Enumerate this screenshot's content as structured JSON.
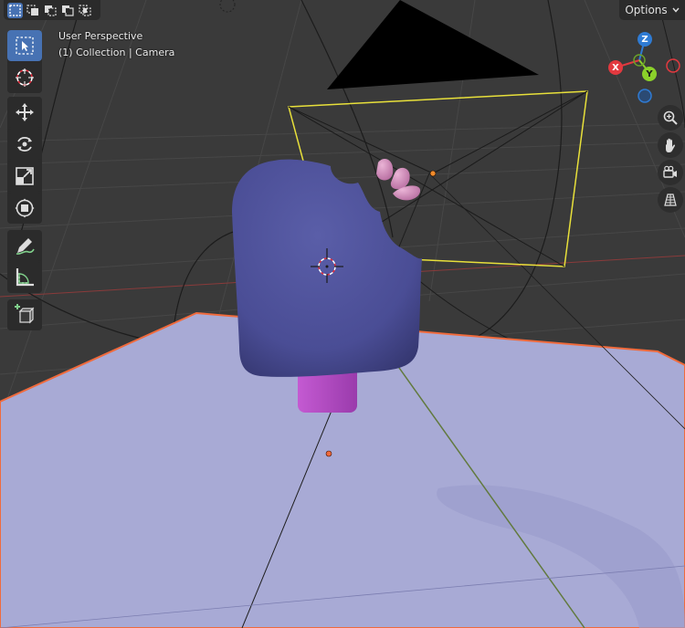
{
  "viewport": {
    "view_name": "User Perspective",
    "collection_info": "(1) Collection | Camera"
  },
  "header": {
    "options_label": "Options",
    "select_modes": [
      "select-new-icon",
      "select-extend-icon",
      "select-subtract-icon",
      "select-invert-icon",
      "select-intersect-icon"
    ]
  },
  "toolbar": {
    "tools": [
      "select-box-icon",
      "cursor-icon",
      "move-icon",
      "rotate-icon",
      "scale-icon",
      "transform-icon",
      "annotate-icon",
      "measure-icon",
      "add-cube-icon"
    ]
  },
  "gizmo": {
    "z_label": "Z",
    "x_label": "X",
    "y_label": "Y",
    "colors": {
      "x": "#e2393f",
      "y": "#8bd12a",
      "z": "#2f7bd3"
    }
  },
  "colors": {
    "background": "#3a3a3a",
    "panel": "#2b2b2b",
    "active": "#4772b3",
    "plane": "#a8aad5",
    "popsicle": "#4c4f98",
    "stick": "#b54bc4",
    "selection_outline": "#f06a3c",
    "camera_frame": "#e8e03a"
  }
}
